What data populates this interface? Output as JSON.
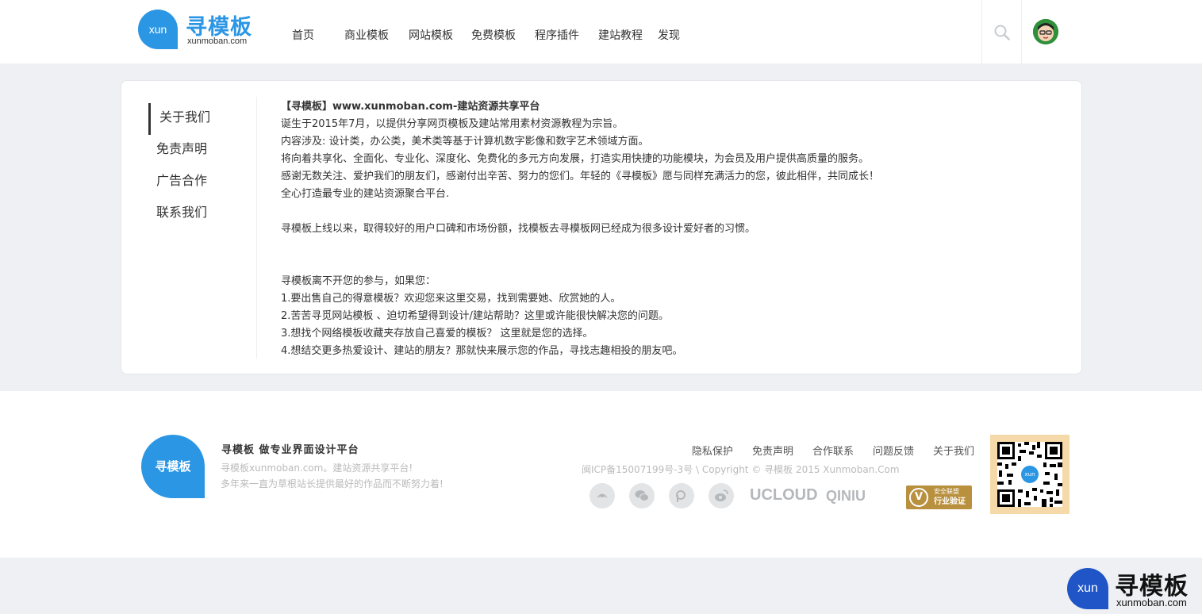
{
  "header": {
    "logo_mark": "xun",
    "logo_title": "寻模板",
    "logo_subtitle": "xunmoban.com",
    "nav": [
      "首页",
      "商业模板",
      "网站模板",
      "免费模板",
      "程序插件",
      "建站教程",
      "发现"
    ]
  },
  "sidebar": {
    "items": [
      "关于我们",
      "免责声明",
      "广告合作",
      "联系我们"
    ],
    "active_index": 0
  },
  "content": {
    "title": "【寻模板】www.xunmoban.com-建站资源共享平台",
    "para1": [
      "诞生于2015年7月，以提供分享网页模板及建站常用素材资源教程为宗旨。",
      "内容涉及: 设计类，办公类，美术类等基于计算机数字影像和数字艺术领域方面。",
      "将向着共享化、全面化、专业化、深度化、免费化的多元方向发展，打造实用快捷的功能模块，为会员及用户提供高质量的服务。",
      "感谢无数关注、爱护我们的朋友们，感谢付出辛苦、努力的您们。年轻的《寻模板》愿与同样充满活力的您，彼此相伴，共同成长！",
      "全心打造最专业的建站资源聚合平台."
    ],
    "para2": "寻模板上线以来，取得较好的用户口碑和市场份额，找模板去寻模板网已经成为很多设计爱好者的习惯。",
    "para3": [
      "寻模板离不开您的参与，如果您：",
      "1.要出售自己的得意模板？欢迎您来这里交易，找到需要她、欣赏她的人。",
      "2.苦苦寻觅网站模板 、迫切希望得到设计/建站帮助？这里或许能很快解决您的问题。",
      "3.想找个网络模板收藏夹存放自己喜爱的模板？ 这里就是您的选择。",
      "4.想结交更多热爱设计、建站的朋友？那就快来展示您的作品，寻找志趣相投的朋友吧。"
    ]
  },
  "footer": {
    "logo_text": "寻模板",
    "title": "寻模板  做专业界面设计平台",
    "desc1": "寻模板xunmoban.com。建站资源共享平台!",
    "desc2": "多年来一直为草根站长提供最好的作品而不断努力着!",
    "links": [
      "隐私保护",
      "免责声明",
      "合作联系",
      "问题反馈",
      "关于我们"
    ],
    "copyright": "闽ICP备15007199号-3号 \\ Copyright © 寻模板 2015 Xunmoban.Com",
    "brand1": "UCLOUD",
    "brand2": "QINIU",
    "badge_v": "V",
    "badge_line1": "安全联盟",
    "badge_line2": "行业验证",
    "qr_center": "xun"
  },
  "watermark": {
    "mark": "xun",
    "title": "寻模板",
    "subtitle": "xunmoban.com"
  },
  "colors": {
    "brand_blue": "#2b96e4",
    "page_bg": "#eef0f3",
    "badge_gold": "#b8903e",
    "qr_bg": "#f6d9a8"
  }
}
